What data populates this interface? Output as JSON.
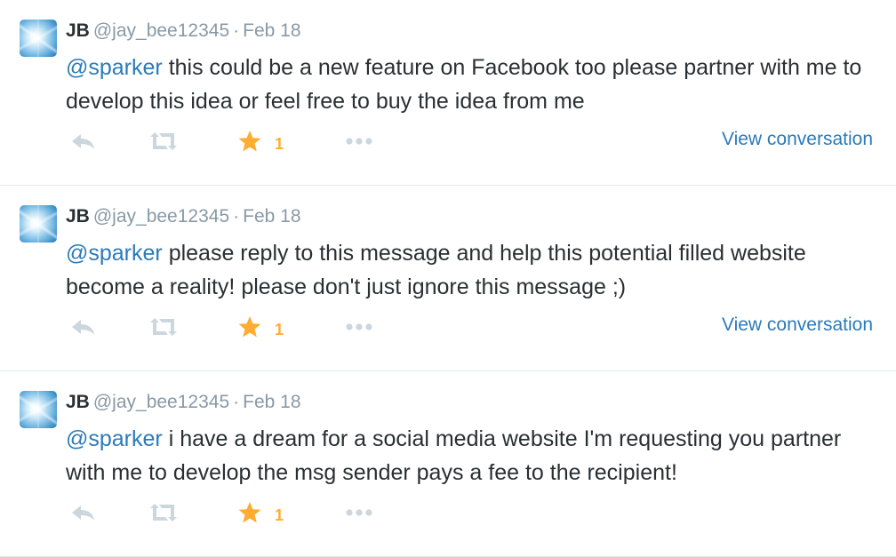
{
  "colors": {
    "link": "#2b7bb9",
    "muted": "#8899a6",
    "favorite": "#ffac33",
    "text": "#292f33"
  },
  "icons": {
    "reply": "reply-icon",
    "retweet": "retweet-icon",
    "favorite": "star-icon",
    "more": "more-icon"
  },
  "tweets": [
    {
      "name": "JB",
      "handle": "@jay_bee12345",
      "separator": "·",
      "date": "Feb 18",
      "mention": "@sparker",
      "text": " this could be a new feature on Facebook too please partner with me to develop this idea or feel free to buy the idea from me",
      "favorites": "1",
      "view_conversation": "View conversation"
    },
    {
      "name": "JB",
      "handle": "@jay_bee12345",
      "separator": "·",
      "date": "Feb 18",
      "mention": "@sparker",
      "text": " please reply to this message and help this potential filled website become a reality! please don't just ignore this message ;)",
      "favorites": "1",
      "view_conversation": "View conversation"
    },
    {
      "name": "JB",
      "handle": "@jay_bee12345",
      "separator": "·",
      "date": "Feb 18",
      "mention": "@sparker",
      "text": " i have a dream for a social media website I'm requesting you partner with me to develop the msg sender pays a fee to the recipient!",
      "favorites": "1"
    }
  ]
}
